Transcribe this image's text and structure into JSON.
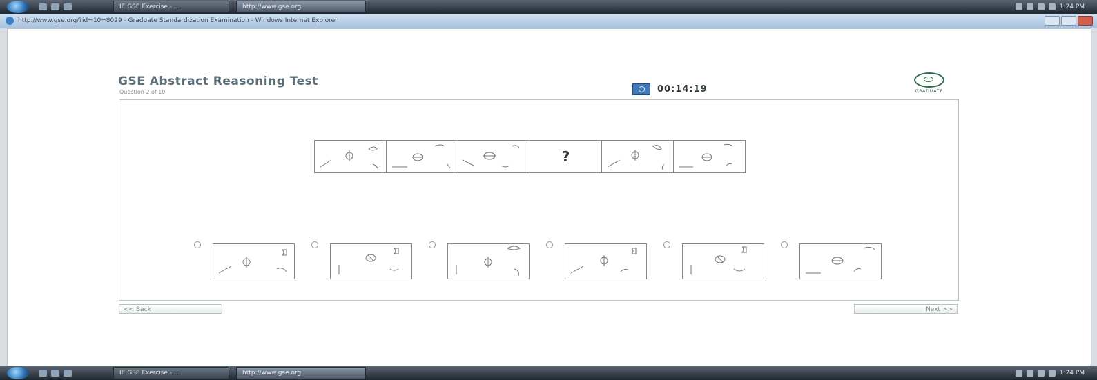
{
  "taskbar": {
    "tasks": [
      "IE GSE Exercise - ...",
      "http://www.gse.org"
    ],
    "clock": "1:24 PM"
  },
  "browser": {
    "title": "http://www.gse.org/?id=10=8029 - Graduate Standardization Examination - Windows Internet Explorer"
  },
  "test": {
    "title": "GSE Abstract Reasoning Test",
    "question_counter": "Question 2 of 10",
    "timer": "00:14:19",
    "logo_text": "GRADUATE"
  },
  "sequence": {
    "cells": [
      "shape",
      "shape",
      "shape",
      "?",
      "shape",
      "shape"
    ]
  },
  "options": {
    "count": 6
  },
  "navigation": {
    "back_label": "<< Back",
    "next_label": "Next >>"
  },
  "colors": {
    "title": "#5c6f78",
    "accent": "#3f79b8",
    "logo": "#2e6b4a"
  }
}
